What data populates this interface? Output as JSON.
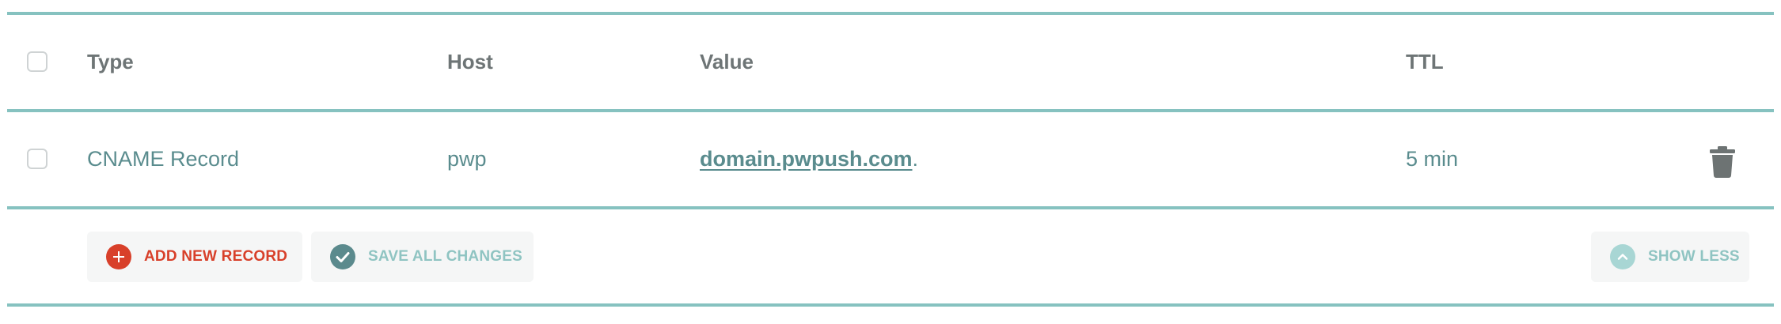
{
  "table": {
    "headers": {
      "type": "Type",
      "host": "Host",
      "value": "Value",
      "ttl": "TTL"
    },
    "records": [
      {
        "type": "CNAME Record",
        "host": "pwp",
        "value": "domain.pwpush.com",
        "value_suffix": ".",
        "ttl": "5 min"
      }
    ]
  },
  "actions": {
    "add_label": "ADD NEW RECORD",
    "save_label": "SAVE ALL CHANGES",
    "show_less_label": "SHOW LESS"
  },
  "colors": {
    "accent_rule": "#86c2c0",
    "add_red": "#d8402a",
    "teal_text": "#5a8c8e",
    "muted_teal": "#8fc4c2"
  },
  "icons": {
    "add": "plus-circle-icon",
    "save": "check-circle-icon",
    "show_less": "chevron-up-circle-icon",
    "delete": "trash-icon"
  }
}
